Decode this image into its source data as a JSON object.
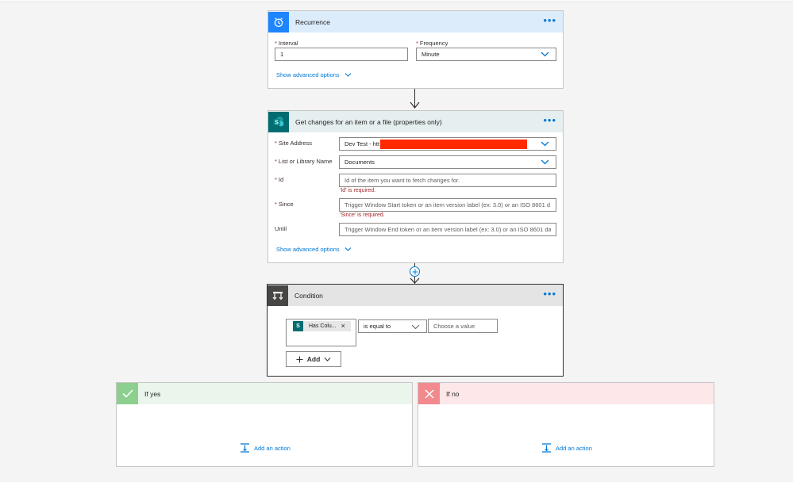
{
  "recurrence": {
    "title": "Recurrence",
    "more_icon": "more-dots-icon",
    "interval_label": "Interval",
    "interval_value": "1",
    "frequency_label": "Frequency",
    "frequency_value": "Minute",
    "advanced_label": "Show advanced options",
    "header_color": "#dcecfb",
    "icon_color": "#1f85ff"
  },
  "sharepoint": {
    "title": "Get changes for an item or a file (properties only)",
    "site_label": "Site Address",
    "site_value": "Dev Test - htt",
    "list_label": "List or Library Name",
    "list_value": "Documents",
    "id_label": "Id",
    "id_placeholder": "Id of the item you want to fetch changes for.",
    "id_error": "'Id' is required.",
    "since_label": "Since",
    "since_placeholder": "Trigger Window Start token or an item version label (ex: 3.0) or an ISO 8601 d",
    "since_error": "'Since' is required.",
    "until_label": "Until",
    "until_placeholder": "Trigger Window End token or an item version label (ex: 3.0) or an ISO 8601 da",
    "advanced_label": "Show advanced options",
    "header_color": "#e6eff0",
    "icon_color": "#036c70"
  },
  "condition": {
    "title": "Condition",
    "token_label": "Has Colu...",
    "operator": "is equal to",
    "value_placeholder": "Choose a value",
    "add_label": "Add",
    "header_color": "#e4e4e4",
    "icon_color": "#484644"
  },
  "if_yes": {
    "title": "If yes",
    "add_action": "Add an action",
    "header_color": "#eaf6ec",
    "icon_color": "#8ccf8e"
  },
  "if_no": {
    "title": "If no",
    "add_action": "Add an action",
    "header_color": "#fde7e9",
    "icon_color": "#f1898e"
  }
}
